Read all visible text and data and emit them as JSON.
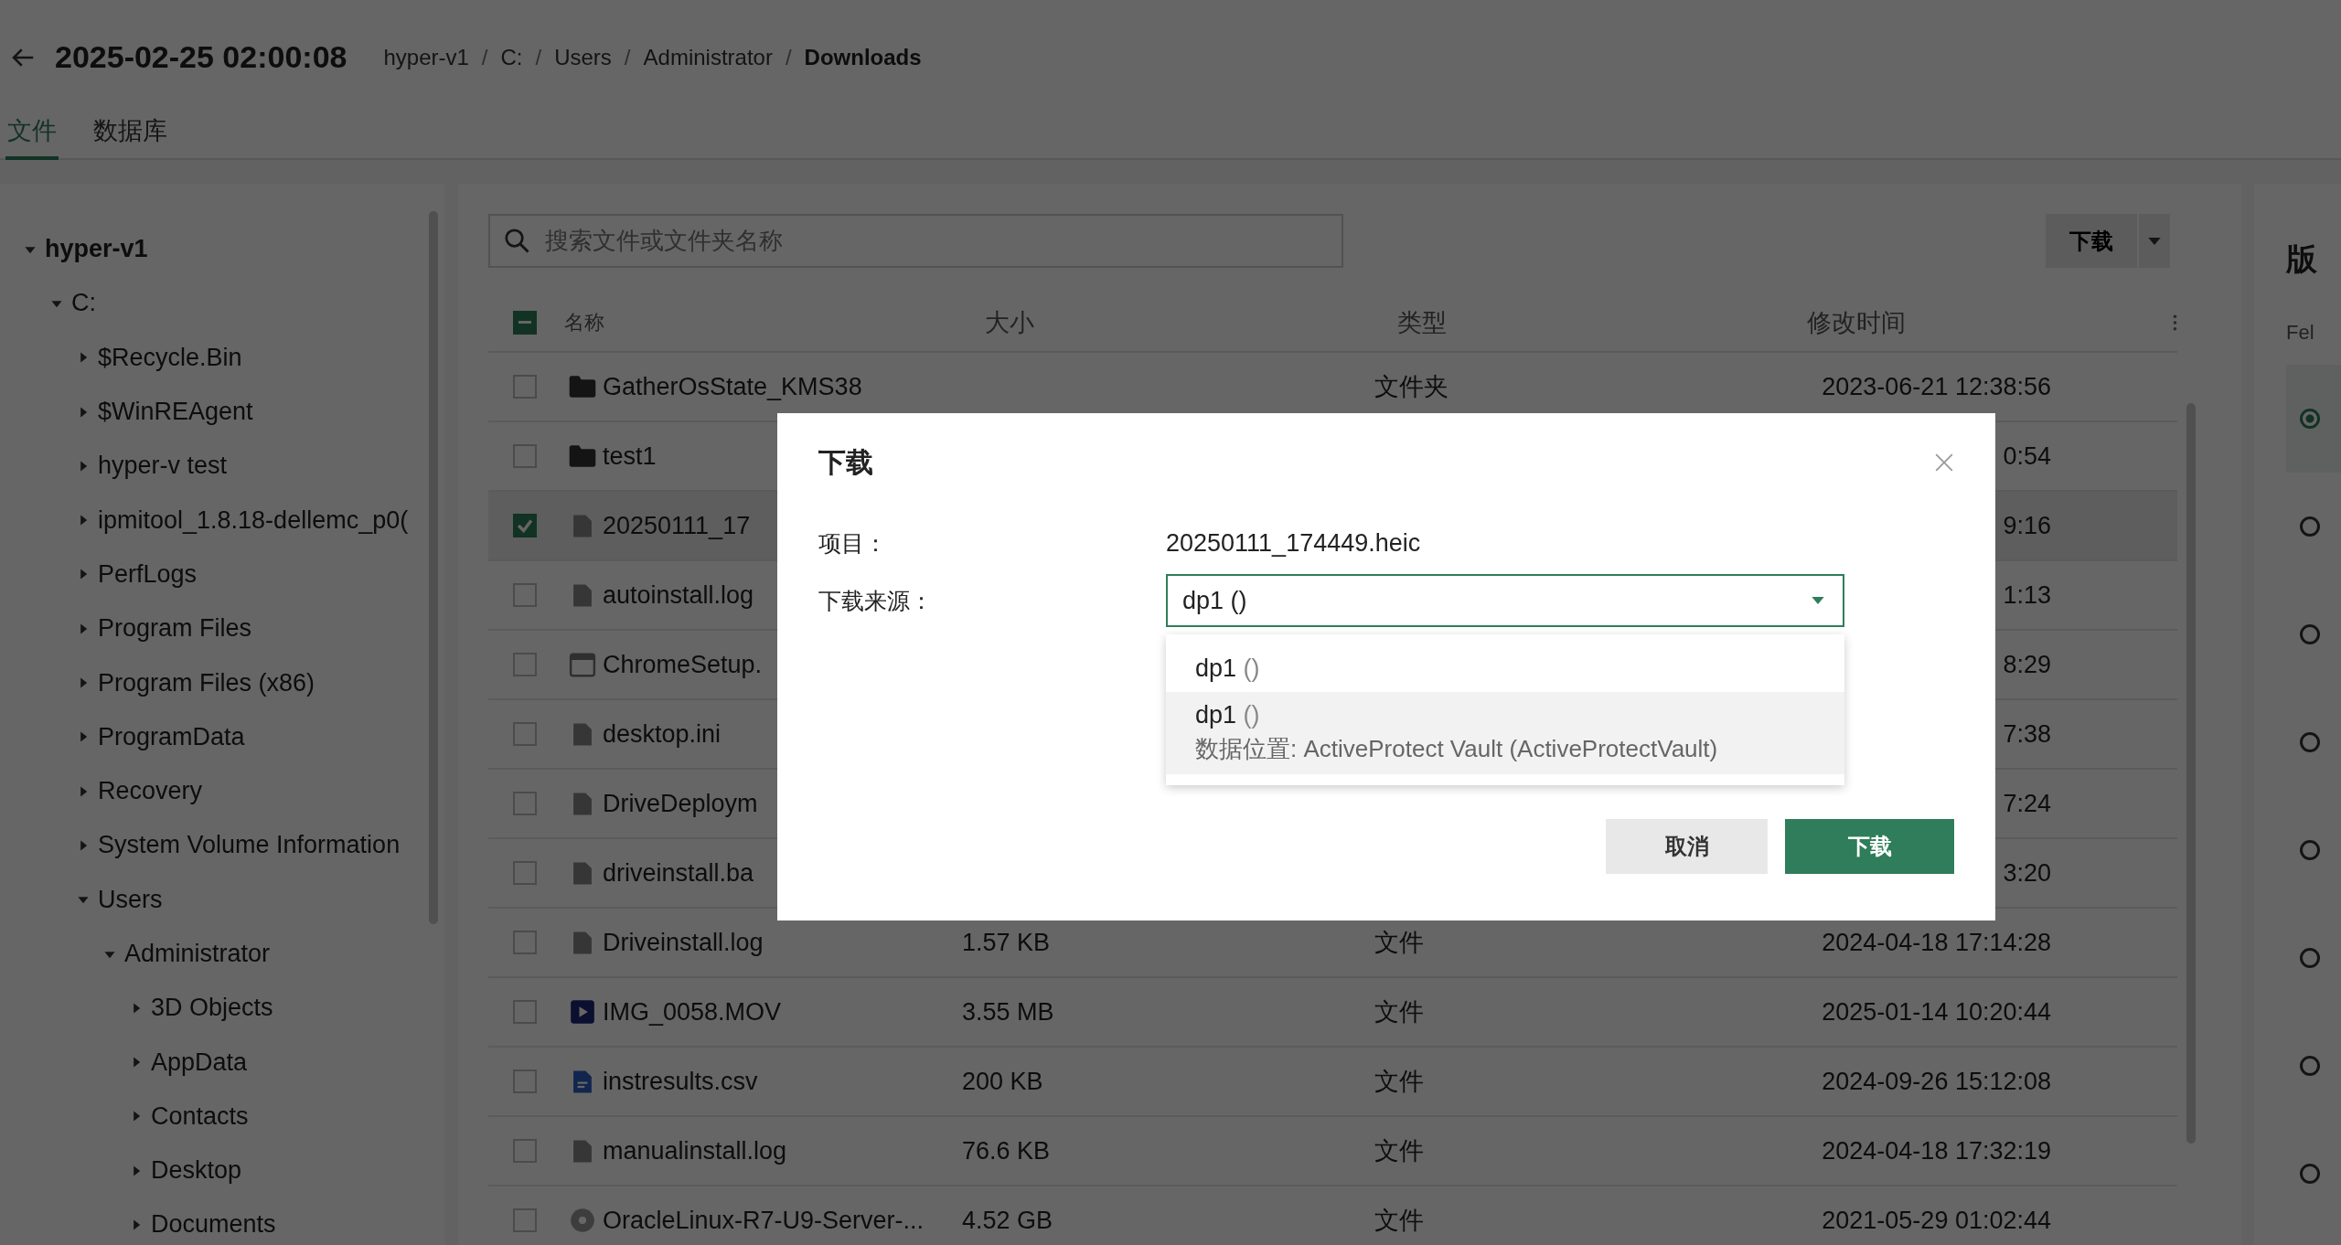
{
  "header": {
    "title": "2025-02-25 02:00:08",
    "separator": "/",
    "breadcrumb": [
      {
        "label": "hyper-v1",
        "current": false
      },
      {
        "label": "C:",
        "current": false
      },
      {
        "label": "Users",
        "current": false
      },
      {
        "label": "Administrator",
        "current": false
      },
      {
        "label": "Downloads",
        "current": true
      }
    ]
  },
  "tabs": [
    {
      "label": "文件",
      "selected": true
    },
    {
      "label": "数据库",
      "selected": false
    }
  ],
  "tree": [
    {
      "label": "hyper-v1",
      "expanded": true,
      "children": [
        {
          "label": "C:",
          "expanded": true,
          "children": [
            {
              "label": "$Recycle.Bin",
              "expanded": false
            },
            {
              "label": "$WinREAgent",
              "expanded": false
            },
            {
              "label": "hyper-v test",
              "expanded": false
            },
            {
              "label": "ipmitool_1.8.18-dellemc_p0(",
              "expanded": false
            },
            {
              "label": "PerfLogs",
              "expanded": false
            },
            {
              "label": "Program Files",
              "expanded": false
            },
            {
              "label": "Program Files (x86)",
              "expanded": false
            },
            {
              "label": "ProgramData",
              "expanded": false
            },
            {
              "label": "Recovery",
              "expanded": false
            },
            {
              "label": "System Volume Information",
              "expanded": false
            },
            {
              "label": "Users",
              "expanded": true,
              "children": [
                {
                  "label": "Administrator",
                  "expanded": true,
                  "children": [
                    {
                      "label": "3D Objects",
                      "expanded": false
                    },
                    {
                      "label": "AppData",
                      "expanded": false
                    },
                    {
                      "label": "Contacts",
                      "expanded": false
                    },
                    {
                      "label": "Desktop",
                      "expanded": false
                    },
                    {
                      "label": "Documents",
                      "expanded": false
                    }
                  ]
                }
              ]
            }
          ]
        }
      ]
    }
  ],
  "search": {
    "placeholder": "搜索文件或文件夹名称"
  },
  "download_button": "下载",
  "table": {
    "header_indeterminate": true,
    "columns": [
      "名称",
      "大小",
      "类型",
      "修改时间"
    ],
    "rows": [
      {
        "kind": "folder",
        "name": "GatherOsState_KMS38",
        "size": "",
        "type": "文件夹",
        "modified": "2023-06-21 12:38:56",
        "checked": false
      },
      {
        "kind": "folder",
        "name": "test1",
        "size": "",
        "type": "",
        "modified": "0:54",
        "checked": false
      },
      {
        "kind": "file",
        "name": "20250111_17",
        "size": "",
        "type": "",
        "modified": "9:16",
        "checked": true
      },
      {
        "kind": "file",
        "name": "autoinstall.log",
        "size": "",
        "type": "",
        "modified": "1:13",
        "checked": false
      },
      {
        "kind": "window",
        "name": "ChromeSetup.",
        "size": "",
        "type": "",
        "modified": "8:29",
        "checked": false
      },
      {
        "kind": "file",
        "name": "desktop.ini",
        "size": "",
        "type": "",
        "modified": "7:38",
        "checked": false
      },
      {
        "kind": "file",
        "name": "DriveDeploym",
        "size": "",
        "type": "",
        "modified": "7:24",
        "checked": false
      },
      {
        "kind": "file",
        "name": "driveinstall.ba",
        "size": "",
        "type": "",
        "modified": "3:20",
        "checked": false
      },
      {
        "kind": "file",
        "name": "Driveinstall.log",
        "size": "1.57 KB",
        "type": "文件",
        "modified": "2024-04-18 17:14:28",
        "checked": false
      },
      {
        "kind": "video",
        "name": "IMG_0058.MOV",
        "size": "3.55 MB",
        "type": "文件",
        "modified": "2025-01-14 10:20:44",
        "checked": false
      },
      {
        "kind": "doc",
        "name": "instresults.csv",
        "size": "200 KB",
        "type": "文件",
        "modified": "2024-09-26 15:12:08",
        "checked": false
      },
      {
        "kind": "file",
        "name": "manualinstall.log",
        "size": "76.6 KB",
        "type": "文件",
        "modified": "2024-04-18 17:32:19",
        "checked": false
      },
      {
        "kind": "disc",
        "name": "OracleLinux-R7-U9-Server-...",
        "size": "4.52 GB",
        "type": "文件",
        "modified": "2021-05-29 01:02:44",
        "checked": false
      }
    ]
  },
  "versions": {
    "title": "版",
    "column": "Fel",
    "items": [
      {
        "selected": true
      },
      {
        "selected": false
      },
      {
        "selected": false
      },
      {
        "selected": false
      },
      {
        "selected": false
      },
      {
        "selected": false
      },
      {
        "selected": false
      },
      {
        "selected": false
      }
    ]
  },
  "dialog": {
    "title": "下载",
    "item_label": "项目：",
    "item_value": "20250111_174449.heic",
    "source_label": "下载来源：",
    "source_value": "dp1 ()",
    "options": [
      {
        "name": "dp1",
        "note": "()",
        "highlighted": false
      },
      {
        "name": "dp1",
        "note": "()",
        "detail": "数据位置: ActiveProtect Vault (ActiveProtectVault)",
        "highlighted": true
      }
    ],
    "cancel": "取消",
    "confirm": "下载"
  }
}
